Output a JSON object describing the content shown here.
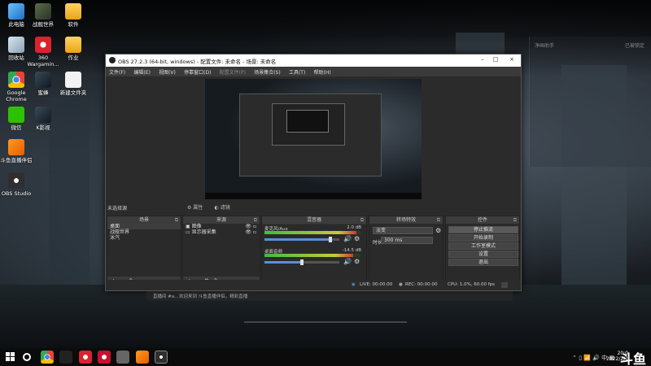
{
  "desktop_icons": {
    "this_pc": "此电脑",
    "game_world": "战舰世界",
    "software": "软件",
    "recycle_bin": "回收站",
    "wargaming": "360 Wargamin...",
    "homework": "作业",
    "chrome": "Google Chrome",
    "bee": "蜜蜂",
    "new_folder": "新建文件夹",
    "wechat": "微信",
    "k_video": "K影视",
    "douyu": "斗鱼直播伴侣",
    "obs": "OBS Studio"
  },
  "bg_window": {
    "title": "净画助手",
    "badge": "已被锁定"
  },
  "obs": {
    "title": "OBS 27.2.3 (64-bit, windows) - 配置文件: 未命名 - 场景: 未命名",
    "menu": {
      "file": "文件(F)",
      "edit": "编辑(E)",
      "view": "视图(V)",
      "dock": "停靠窗口(D)",
      "profile": "配置文件(P)",
      "scene_collection": "场景集合(S)",
      "tools": "工具(T)",
      "help": "帮助(H)"
    },
    "no_source_selected": "未选择源",
    "source_props": "属性",
    "source_filters": "滤镜",
    "docks": {
      "scenes": "场景",
      "sources": "来源",
      "mixer": "混音器",
      "transitions": "转场特效",
      "controls": "控件"
    },
    "scenes": [
      "桌面",
      "战舰世界",
      "泳汽"
    ],
    "sources": [
      "图像",
      "显示器采集"
    ],
    "mixer": [
      {
        "name": "麦克风/Aux",
        "db": "2.0 dB",
        "level": 0.96,
        "volume": 0.88
      },
      {
        "name": "桌面音频",
        "db": "-14.5 dB",
        "level": 0.92,
        "volume": 0.5
      }
    ],
    "transition": {
      "type": "淡变",
      "duration_label": "时长",
      "duration": "300 ms"
    },
    "controls": {
      "stop_stream": "停止推流",
      "start_record": "开始录制",
      "studio_mode": "工作室模式",
      "settings": "设置",
      "exit": "退出"
    },
    "status": {
      "dropped": "0",
      "live": "LIVE: 00:00:00",
      "rec": "REC: 00:00:00",
      "cpu": "CPU: 1.0%, 60.00 fps"
    }
  },
  "strip": {
    "item1": "直播间 #a...",
    "item2": "欢迎来到 斗鱼直播伴侣，精彩直播"
  },
  "taskbar": {
    "time": "20:0",
    "date": "2022/2/1"
  },
  "watermark": "斗鱼"
}
